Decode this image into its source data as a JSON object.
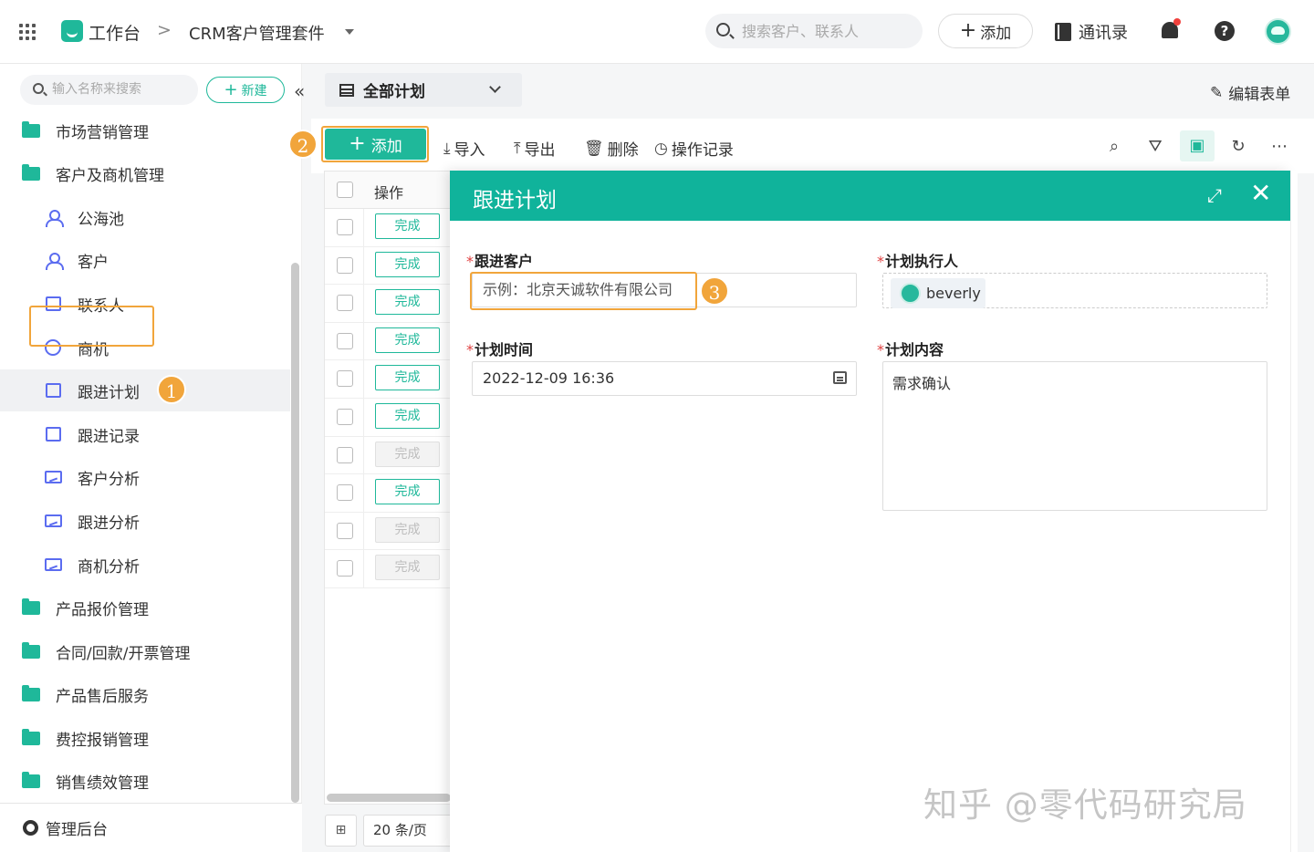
{
  "topbar": {
    "workspace": "工作台",
    "separator": ">",
    "app_name": "CRM客户管理套件",
    "search_placeholder": "搜索客户、联系人",
    "add_label": "添加",
    "contacts_label": "通讯录"
  },
  "sidebar": {
    "search_placeholder": "输入名称来搜索",
    "new_label": "新建",
    "items": [
      {
        "label": "市场营销管理",
        "type": "group",
        "icon": "folder-icon"
      },
      {
        "label": "客户及商机管理",
        "type": "group",
        "icon": "folder-icon"
      },
      {
        "label": "公海池",
        "type": "sub",
        "icon": "person-group-icon"
      },
      {
        "label": "客户",
        "type": "sub",
        "icon": "person-icon"
      },
      {
        "label": "联系人",
        "type": "sub",
        "icon": "contact-book-icon"
      },
      {
        "label": "商机",
        "type": "sub",
        "icon": "opportunity-icon"
      },
      {
        "label": "跟进计划",
        "type": "sub",
        "icon": "calendar-list-icon",
        "active": true
      },
      {
        "label": "跟进记录",
        "type": "sub",
        "icon": "record-icon"
      },
      {
        "label": "客户分析",
        "type": "sub",
        "icon": "chart-monitor-icon"
      },
      {
        "label": "跟进分析",
        "type": "sub",
        "icon": "chart-monitor-icon"
      },
      {
        "label": "商机分析",
        "type": "sub",
        "icon": "chart-monitor-icon"
      },
      {
        "label": "产品报价管理",
        "type": "group",
        "icon": "folder-icon"
      },
      {
        "label": "合同/回款/开票管理",
        "type": "group",
        "icon": "folder-icon"
      },
      {
        "label": "产品售后服务",
        "type": "group",
        "icon": "folder-icon"
      },
      {
        "label": "费控报销管理",
        "type": "group",
        "icon": "folder-icon"
      },
      {
        "label": "销售绩效管理",
        "type": "group",
        "icon": "folder-icon"
      }
    ],
    "footer_label": "管理后台"
  },
  "main": {
    "view_label": "全部计划",
    "edit_form_label": "编辑表单",
    "toolbar": {
      "add_label": "添加",
      "import_label": "导入",
      "export_label": "导出",
      "delete_label": "删除",
      "log_label": "操作记录"
    },
    "table": {
      "action_header": "操作",
      "rows": [
        {
          "action": "完成",
          "enabled": true
        },
        {
          "action": "完成",
          "enabled": true
        },
        {
          "action": "完成",
          "enabled": true
        },
        {
          "action": "完成",
          "enabled": true
        },
        {
          "action": "完成",
          "enabled": true
        },
        {
          "action": "完成",
          "enabled": true
        },
        {
          "action": "完成",
          "enabled": false
        },
        {
          "action": "完成",
          "enabled": true
        },
        {
          "action": "完成",
          "enabled": false
        },
        {
          "action": "完成",
          "enabled": false
        }
      ]
    },
    "pager": {
      "page_size": "20 条/页"
    }
  },
  "modal": {
    "title": "跟进计划",
    "required_mark": "*",
    "customer_label": "跟进客户",
    "customer_placeholder": "示例：北京天诚软件有限公司",
    "owner_label": "计划执行人",
    "owner_value": "beverly",
    "time_label": "计划时间",
    "time_value": "2022-12-09 16:36",
    "content_label": "计划内容",
    "content_value": "需求确认"
  },
  "annotations": {
    "badge1": "1",
    "badge2": "2",
    "badge3": "3"
  },
  "watermark": "知乎 @零代码研究局",
  "colors": {
    "accent": "#1fb89a",
    "modal_header": "#10b39b",
    "highlight": "#f1a53b",
    "sub_icon": "#5b6cf0"
  }
}
